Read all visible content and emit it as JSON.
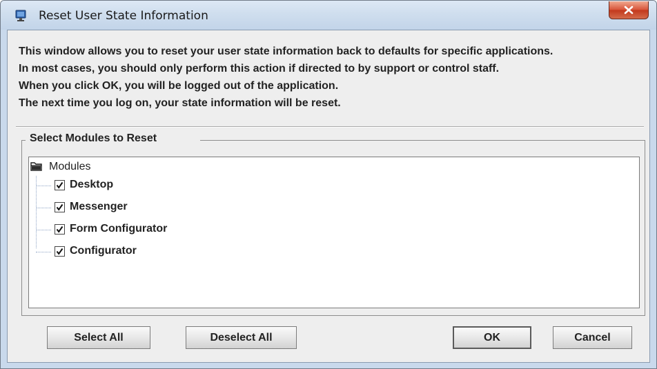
{
  "window": {
    "title": "Reset User State Information"
  },
  "intro_lines": [
    "This window allows you to reset your user state information back to defaults for specific applications.",
    "In most cases, you should only perform this action if directed to by support or control staff.",
    "When you click OK, you will be logged out of the application.",
    "The next time you log on, your state information will be reset."
  ],
  "modules_group": {
    "legend": "Select Modules to Reset",
    "root_label": "Modules",
    "root_icon": "folder-icon",
    "items": [
      {
        "label": "Desktop",
        "checked": true
      },
      {
        "label": "Messenger",
        "checked": true
      },
      {
        "label": "Form Configurator",
        "checked": true
      },
      {
        "label": "Configurator",
        "checked": true
      }
    ]
  },
  "buttons": {
    "select_all": "Select All",
    "deselect_all": "Deselect All",
    "ok": "OK",
    "cancel": "Cancel"
  },
  "colors": {
    "title_bar": "#cfdeee",
    "close_button": "#c2391d",
    "dialog_background": "#eeeeee"
  }
}
